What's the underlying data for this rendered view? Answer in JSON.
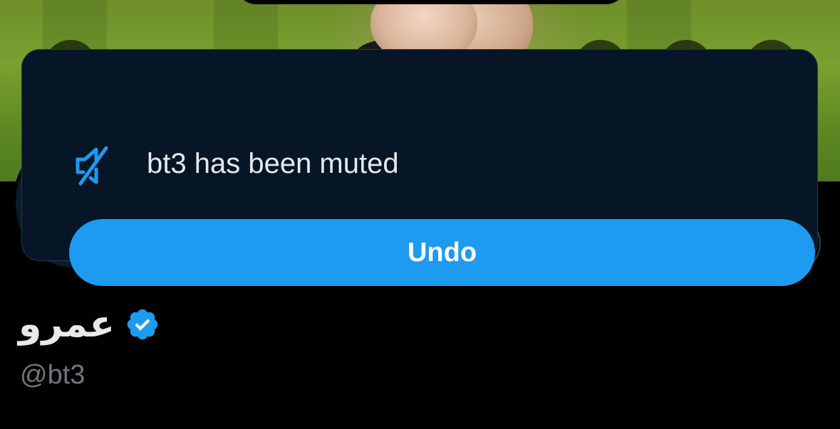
{
  "profile": {
    "display_name": "عمرو",
    "handle": "@bt3",
    "verified": true
  },
  "toast": {
    "message": "bt3 has been muted",
    "undo_label": "Undo",
    "icon": "muted-speaker-icon"
  },
  "colors": {
    "accent": "#1d9bf0",
    "toast_bg": "#061626",
    "background": "#000000",
    "text_primary": "#e7e9ea",
    "text_secondary": "#71767b"
  }
}
